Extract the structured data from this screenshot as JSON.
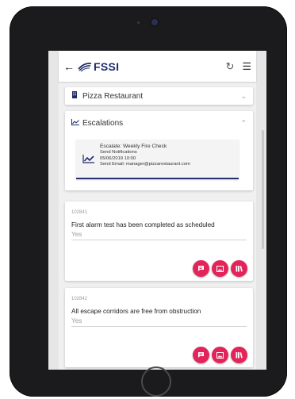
{
  "header": {
    "logo_text": "FSSI"
  },
  "site": {
    "name": "Pizza Restaurant"
  },
  "escalations": {
    "title": "Escalations",
    "item": {
      "title": "Escalate: Weekly Fire Check",
      "line1": "Send Notifications",
      "line2": "05/06/2019 10:00",
      "line3": "Send Email: manager@pizzarestaurant.com"
    }
  },
  "questions": [
    {
      "id": "102841",
      "text": "First alarm test has been completed as scheduled",
      "answer": "Yes"
    },
    {
      "id": "102842",
      "text": "All escape corridors are free from obstruction",
      "answer": "Yes"
    }
  ],
  "colors": {
    "brand": "#1c2a6b",
    "action": "#e3245a"
  }
}
